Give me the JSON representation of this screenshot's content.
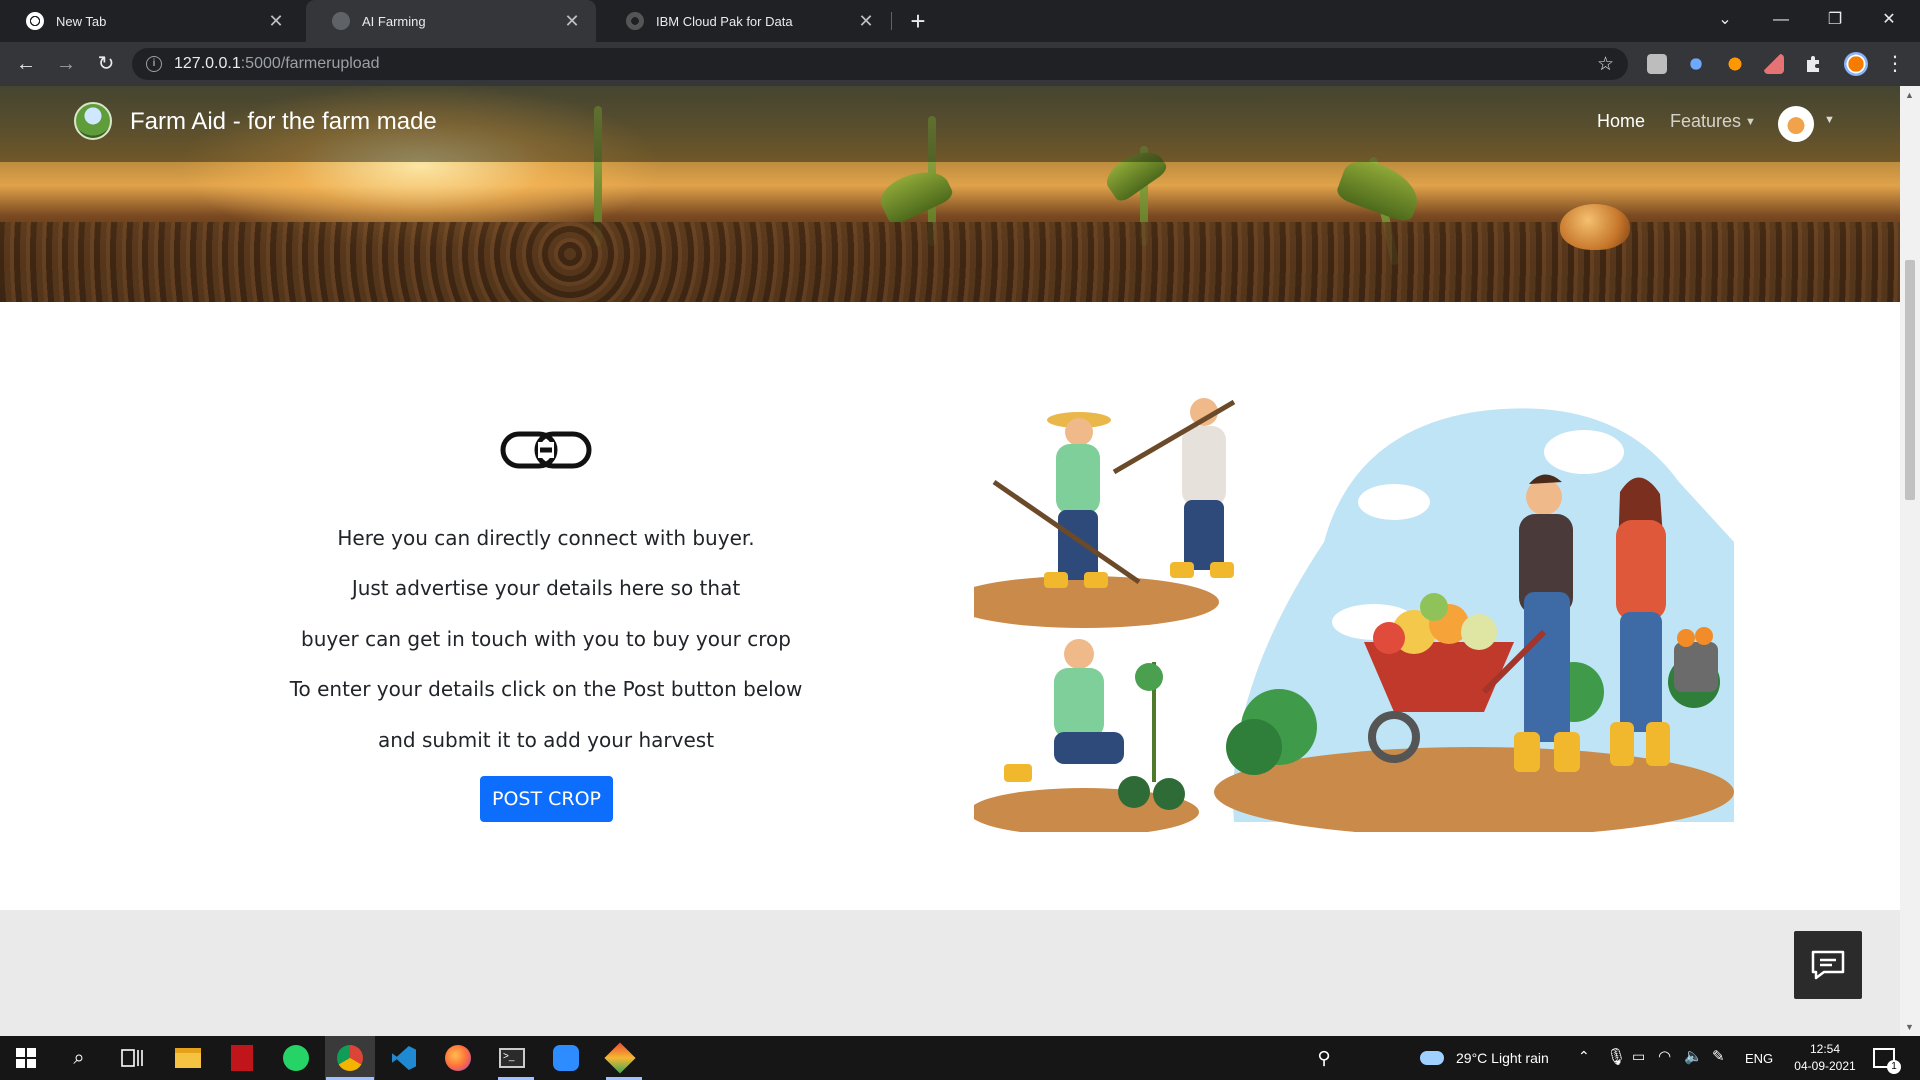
{
  "browser": {
    "tabs": [
      {
        "title": "New Tab",
        "active": false
      },
      {
        "title": "AI Farming",
        "active": true
      },
      {
        "title": "IBM Cloud Pak for Data",
        "active": false
      }
    ],
    "url_host": "127.0.0.1",
    "url_path": ":5000/farmerupload",
    "colors": {
      "frame": "#202124",
      "toolbar": "#35363a"
    }
  },
  "navbar": {
    "brand": "Farm Aid - for the farm made",
    "home": "Home",
    "features": "Features"
  },
  "main": {
    "lines": [
      "Here you can directly connect with buyer.",
      "Just advertise your details here so that",
      "buyer can get in touch with you to buy your crop",
      "To enter your details click on the Post button below",
      "and submit it to add your harvest"
    ],
    "post_button": "POST CROP",
    "button_color": "#0d6efd"
  },
  "taskbar": {
    "weather": "29°C  Light rain",
    "language": "ENG",
    "time": "12:54",
    "date": "04-09-2021",
    "notification_count": "1"
  }
}
